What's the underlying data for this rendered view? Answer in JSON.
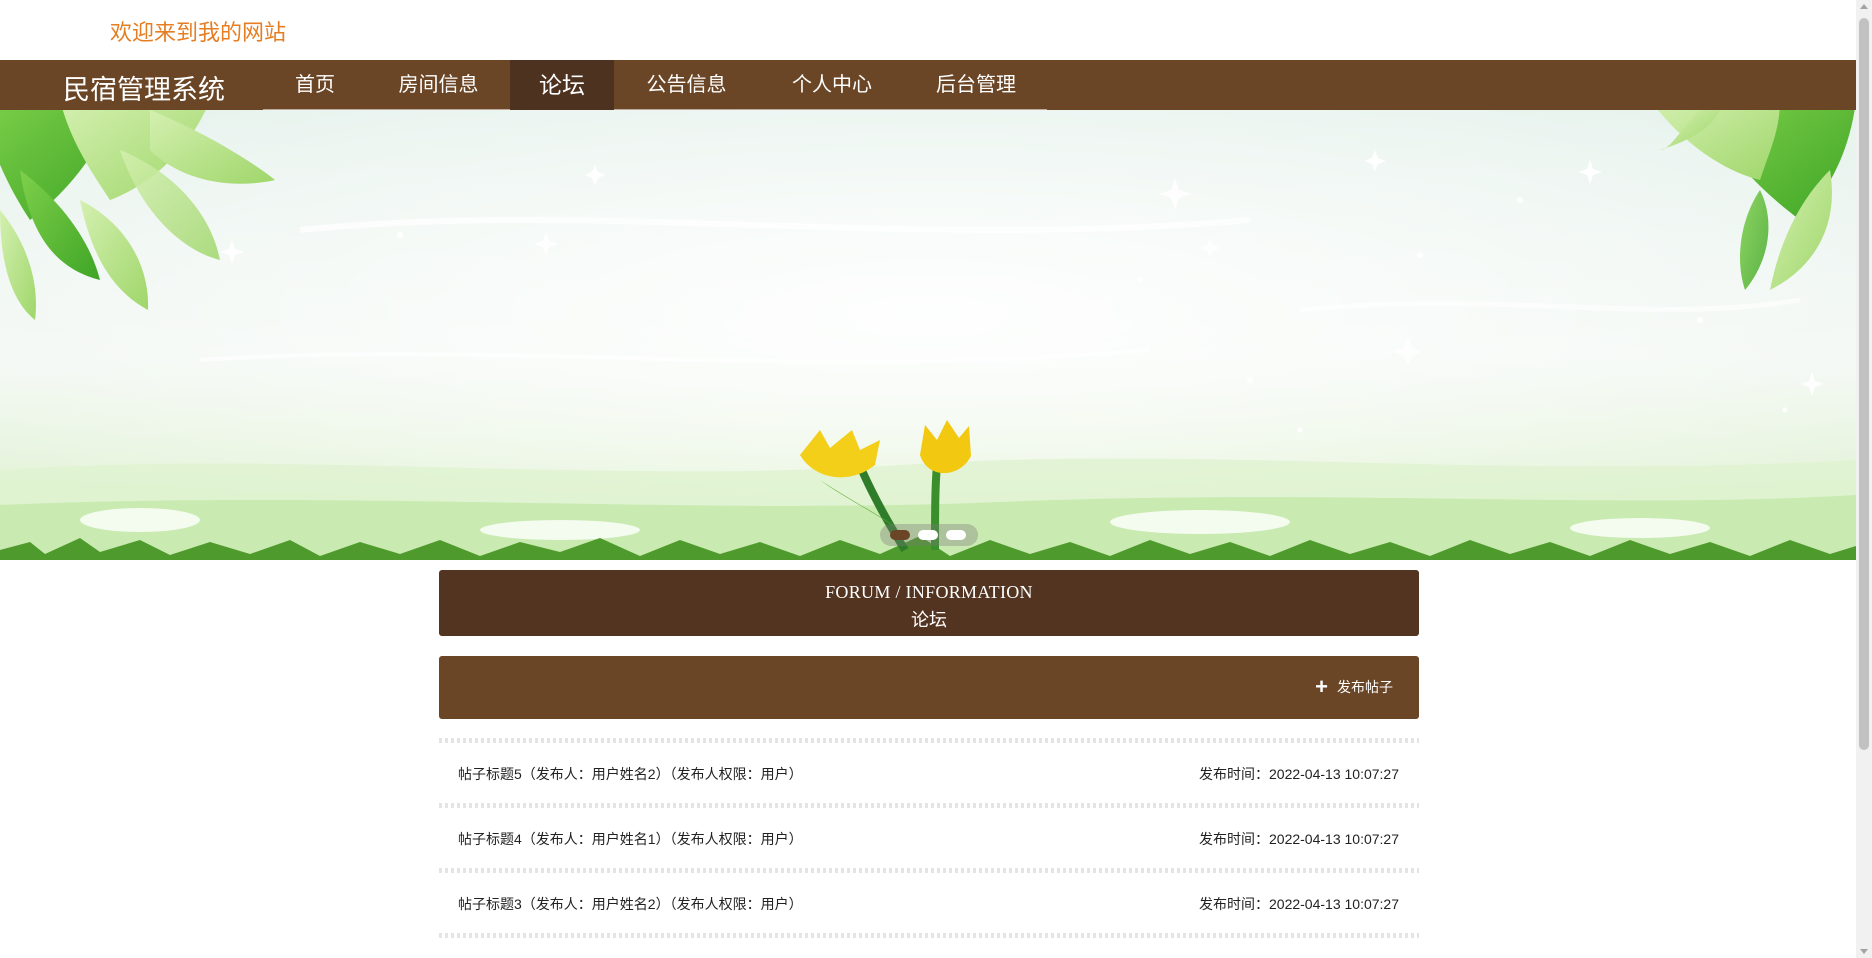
{
  "header": {
    "welcome": "欢迎来到我的网站"
  },
  "nav": {
    "brand": "民宿管理系统",
    "items": [
      {
        "label": "首页"
      },
      {
        "label": "房间信息"
      },
      {
        "label": "论坛"
      },
      {
        "label": "公告信息"
      },
      {
        "label": "个人中心"
      },
      {
        "label": "后台管理"
      }
    ],
    "active": "论坛"
  },
  "banner": {
    "slide_count": 3,
    "active_slide": 1
  },
  "section": {
    "title_en": "FORUM / INFORMATION",
    "title_cn": "论坛"
  },
  "toolbar": {
    "post_button": "发布帖子",
    "post_icon": "plus-icon"
  },
  "posts": [
    {
      "title": "帖子标题5（发布人：用户姓名2）（发布人权限：用户）",
      "time": "发布时间：2022-04-13 10:07:27"
    },
    {
      "title": "帖子标题4（发布人：用户姓名1）（发布人权限：用户）",
      "time": "发布时间：2022-04-13 10:07:27"
    },
    {
      "title": "帖子标题3（发布人：用户姓名2）（发布人权限：用户）",
      "time": "发布时间：2022-04-13 10:07:27"
    }
  ],
  "colors": {
    "nav_bg": "#6b4626",
    "nav_active": "#4e3220",
    "section_bg": "#533421",
    "welcome_text": "#e57e22"
  }
}
